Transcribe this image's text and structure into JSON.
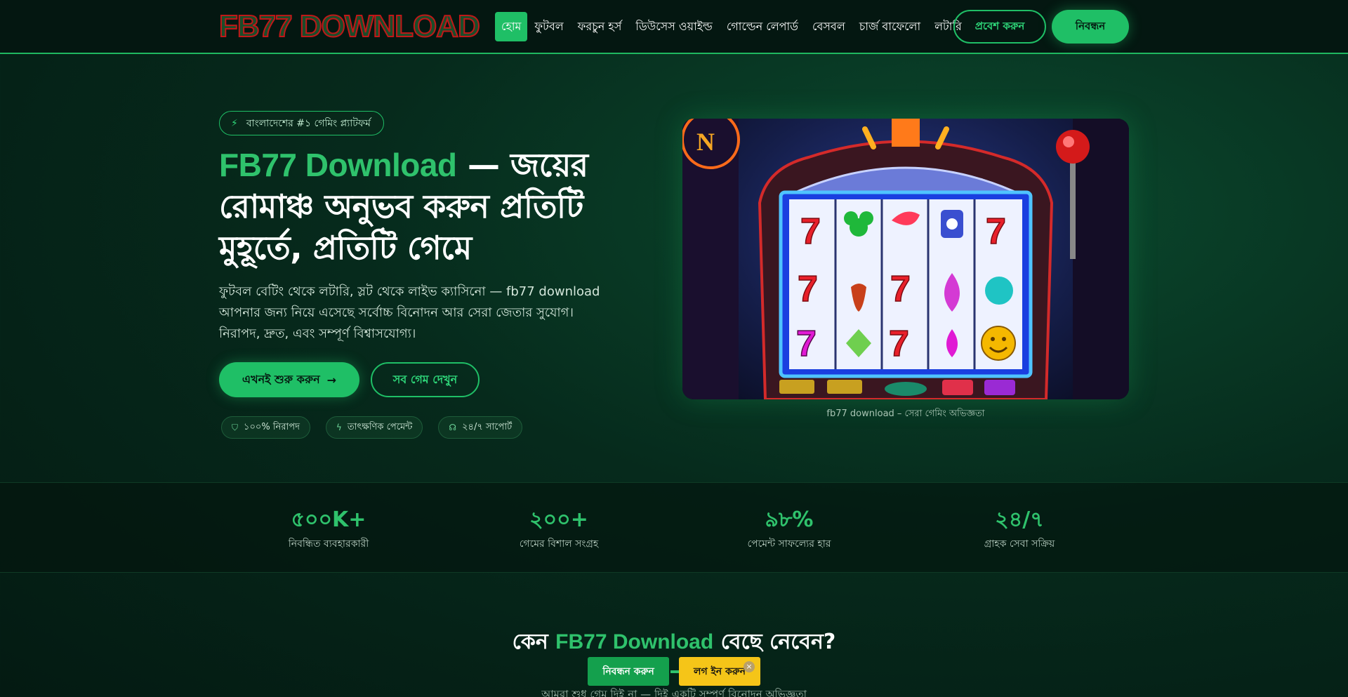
{
  "header": {
    "logo": "FB77 DOWNLOAD",
    "nav": [
      "হোম",
      "ফুটবল",
      "ফরচুন হর্স",
      "ডিউসেস ওয়াইল্ড",
      "গোল্ডেন লেপার্ড",
      "বেসবল",
      "চার্জ বাফেলো",
      "লটারি"
    ],
    "login_label": "প্রবেশ করুন",
    "register_label": "নিবন্ধন"
  },
  "hero": {
    "badge": "বাংলাদেশের #১ গেমিং প্ল্যাটফর্ম",
    "title_highlight": "FB77 Download",
    "title_rest": " — জয়ের রোমাঞ্চ অনুভব করুন প্রতিটি মুহূর্তে, প্রতিটি গেমে",
    "lead": "ফুটবল বেটিং থেকে লটারি, স্লট থেকে লাইভ ক্যাসিনো — fb77 download আপনার জন্য নিয়ে এসেছে সর্বোচ্চ বিনোদন আর সেরা জেতার সুযোগ। নিরাপদ, দ্রুত, এবং সম্পূর্ণ বিশ্বাসযোগ্য।",
    "cta_primary": "এখনই শুরু করুন",
    "cta_secondary": "সব গেম দেখুন",
    "chips": [
      "১০০% নিরাপদ",
      "তাৎক্ষণিক পেমেন্ট",
      "২৪/৭ সাপোর্ট"
    ],
    "image_caption": "fb77 download – সেরা গেমিং অভিজ্ঞতা"
  },
  "stats": [
    {
      "value": "৫০০K+",
      "label": "নিবন্ধিত ব্যবহারকারী"
    },
    {
      "value": "২০০+",
      "label": "গেমের বিশাল সংগ্রহ"
    },
    {
      "value": "৯৮%",
      "label": "পেমেন্ট সাফল্যের হার"
    },
    {
      "value": "২৪/৭",
      "label": "গ্রাহক সেবা সক্রিয়"
    }
  ],
  "section": {
    "title_pre": "কেন ",
    "title_highlight": "FB77 Download",
    "title_post": " বেছে নেবেন?",
    "subtitle": "আমরা শুধু গেম দিই না — দিই একটি সম্পূর্ণ বিনোদন অভিজ্ঞতা"
  },
  "floating": {
    "register_label": "নিবন্ধন করুন",
    "login_label": "লগ ইন করুন",
    "close_glyph": "×"
  },
  "colors": {
    "accent": "#1fbf66",
    "logo_outline": "#c01818",
    "login_float": "#f5c518"
  }
}
